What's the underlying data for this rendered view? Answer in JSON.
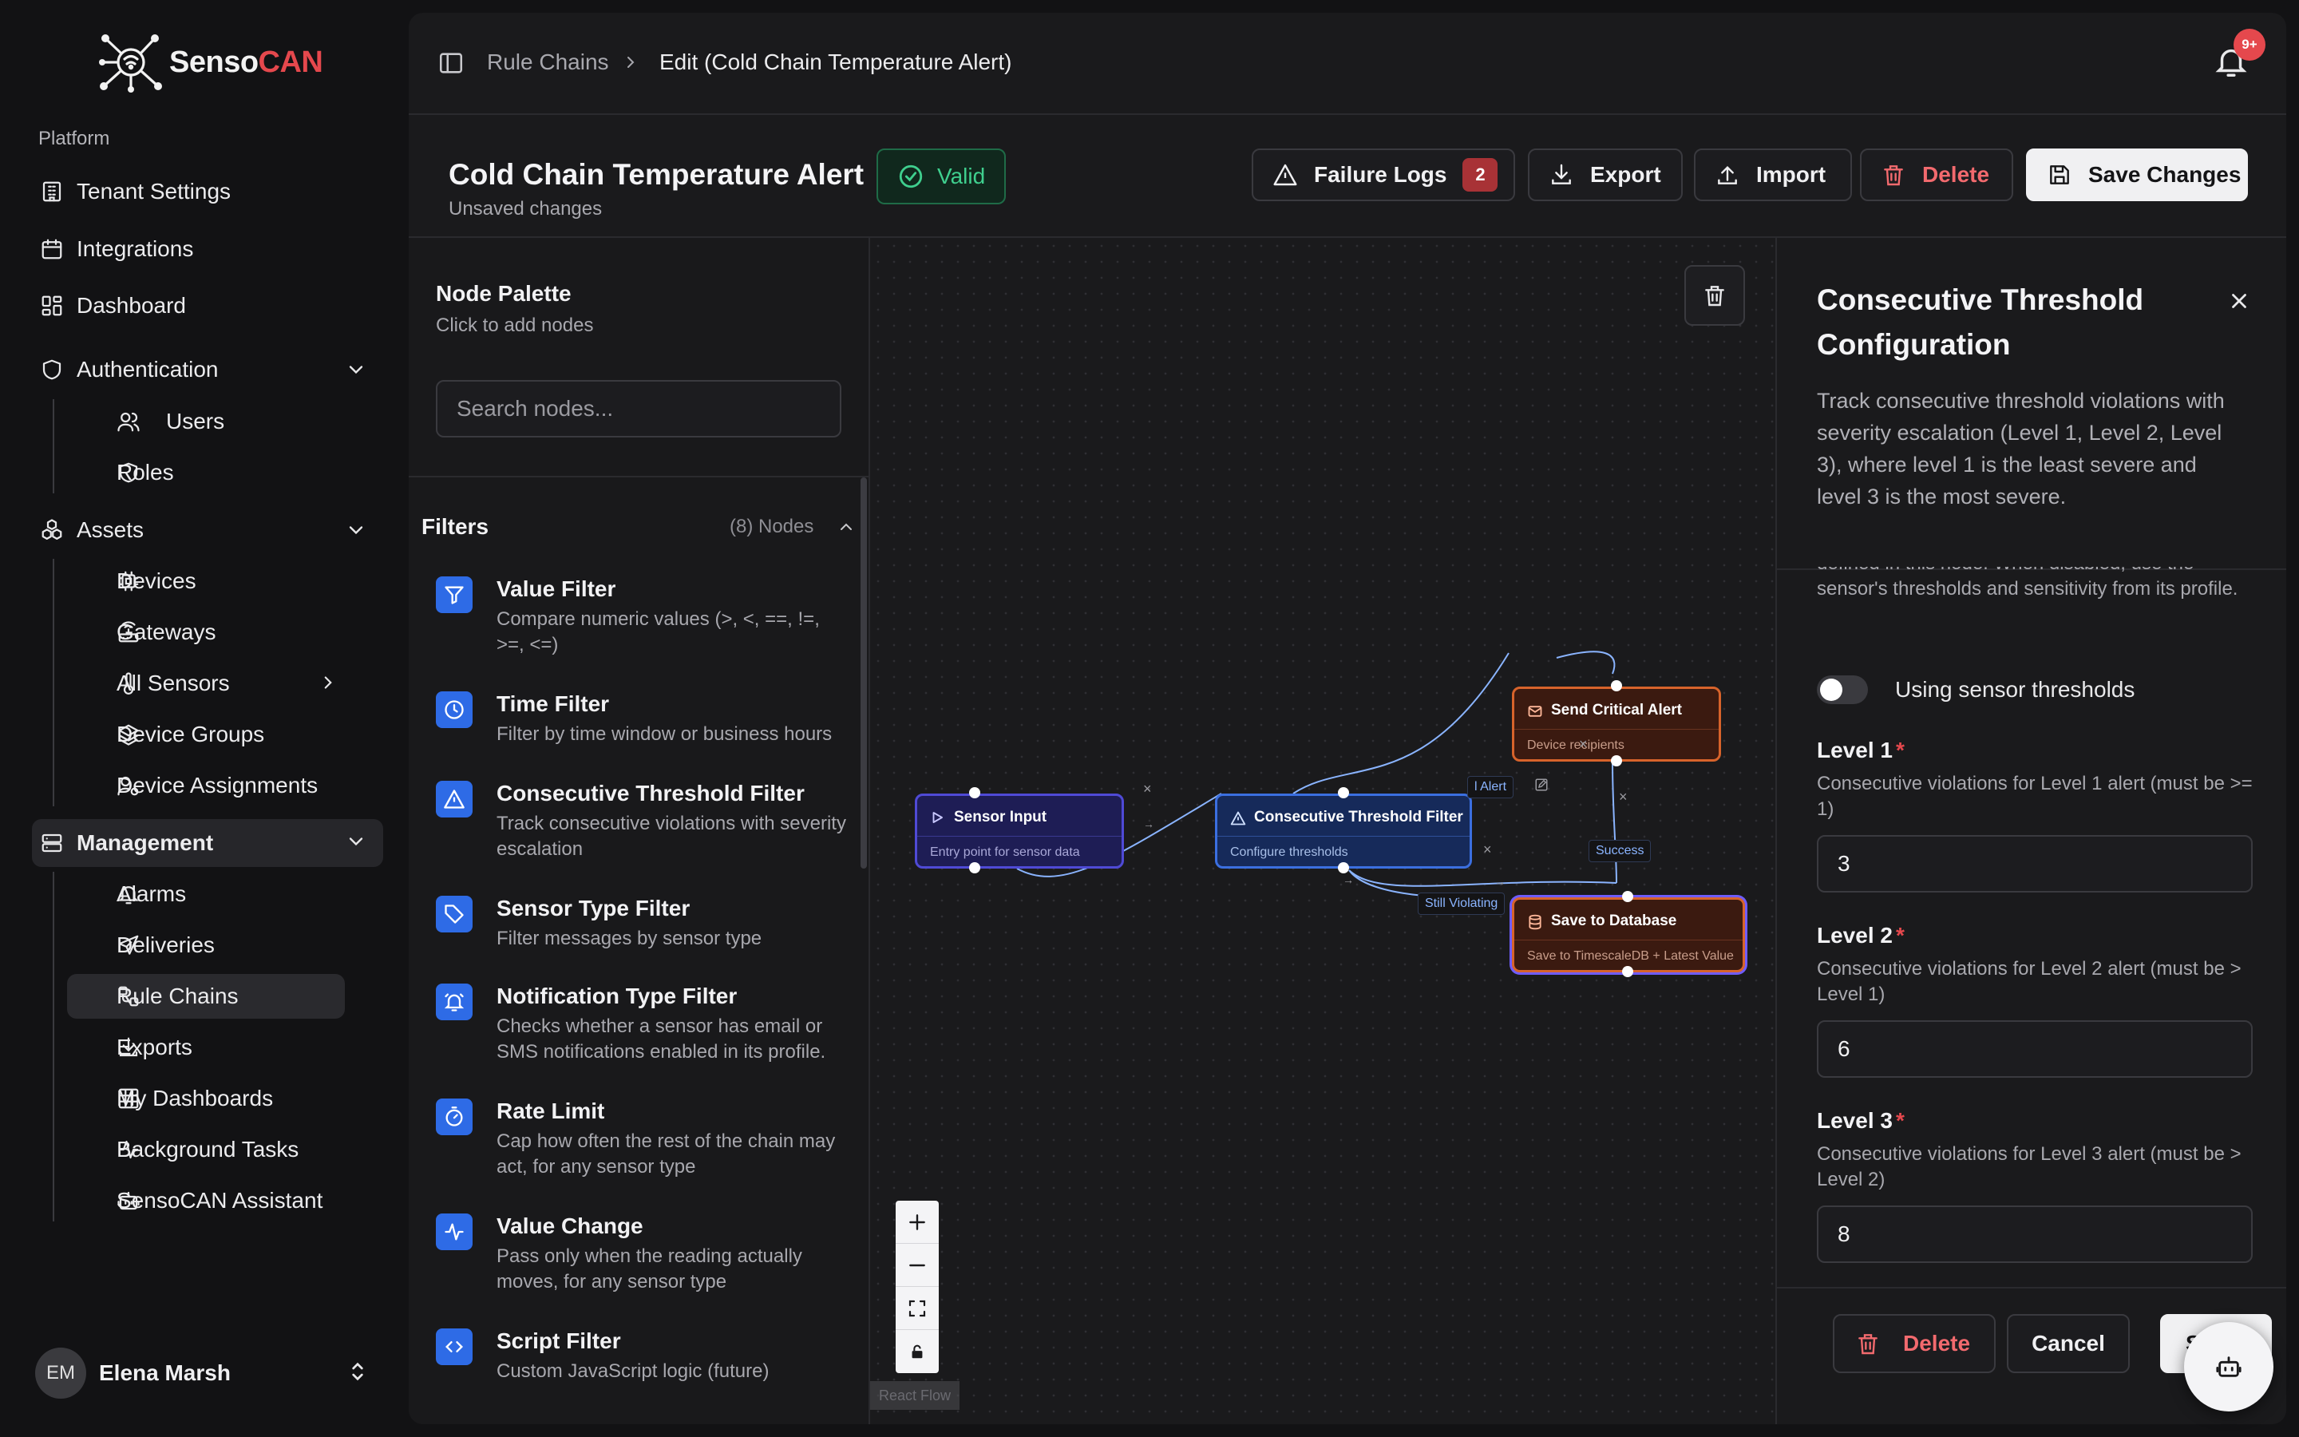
{
  "app": {
    "brand_prefix": "Senso",
    "brand_accent": "CAN",
    "accent_color": "#e5484d"
  },
  "sidebar": {
    "section_label": "Platform",
    "items": {
      "tenant_settings": "Tenant Settings",
      "integrations": "Integrations",
      "dashboard": "Dashboard",
      "authentication": "Authentication",
      "users": "Users",
      "roles": "Roles",
      "assets": "Assets",
      "devices": "Devices",
      "gateways": "Gateways",
      "all_sensors": "All Sensors",
      "device_groups": "Device Groups",
      "device_assignments": "Device Assignments",
      "management": "Management",
      "alarms": "Alarms",
      "deliveries": "Deliveries",
      "rule_chains": "Rule Chains",
      "exports": "Exports",
      "my_dashboards": "My Dashboards",
      "background_tasks": "Background Tasks",
      "senso_assistant": "SensoCAN Assistant"
    },
    "user": {
      "initials": "EM",
      "name": "Elena Marsh"
    }
  },
  "topbar": {
    "breadcrumb_root": "Rule Chains",
    "breadcrumb_current": "Edit (Cold Chain Temperature Alert)",
    "notification_count": "9+"
  },
  "header": {
    "title": "Cold Chain Temperature Alert",
    "subtitle": "Unsaved changes",
    "valid_label": "Valid",
    "failure_logs_label": "Failure Logs",
    "failure_logs_count": "2",
    "export_label": "Export",
    "import_label": "Import",
    "delete_label": "Delete",
    "save_label": "Save Changes"
  },
  "palette": {
    "title": "Node Palette",
    "subtitle": "Click to add nodes",
    "search_placeholder": "Search nodes...",
    "section_title": "Filters",
    "section_count": "(8) Nodes",
    "items": [
      {
        "title": "Value Filter",
        "desc": "Compare numeric values (>, <, ==, !=, >=, <=)",
        "icon": "filter-icon"
      },
      {
        "title": "Time Filter",
        "desc": "Filter by time window or business hours",
        "icon": "clock-icon"
      },
      {
        "title": "Consecutive Threshold Filter",
        "desc": "Track consecutive violations with severity escalation",
        "icon": "warning-icon"
      },
      {
        "title": "Sensor Type Filter",
        "desc": "Filter messages by sensor type",
        "icon": "tag-icon"
      },
      {
        "title": "Notification Type Filter",
        "desc": "Checks whether a sensor has email or SMS notifications enabled in its profile.",
        "icon": "bell-icon"
      },
      {
        "title": "Rate Limit",
        "desc": "Cap how often the rest of the chain may act, for any sensor type",
        "icon": "timer-icon"
      },
      {
        "title": "Value Change",
        "desc": "Pass only when the reading actually moves, for any sensor type",
        "icon": "activity-icon"
      },
      {
        "title": "Script Filter",
        "desc": "Custom JavaScript logic (future)",
        "icon": "code-icon"
      }
    ]
  },
  "canvas": {
    "attribution": "React Flow",
    "nodes": {
      "sensor_input": {
        "title": "Sensor Input",
        "desc": "Entry point for sensor data"
      },
      "threshold": {
        "title": "Consecutive Threshold Filter",
        "desc": "Configure thresholds"
      },
      "critical_alert": {
        "title": "Send Critical Alert",
        "desc": "Device recipients"
      },
      "save_db": {
        "title": "Save to Database",
        "desc": "Save to TimescaleDB + Latest Value"
      }
    },
    "edge_labels": {
      "alert": "l Alert",
      "success": "Success",
      "still_violating": "Still Violating"
    }
  },
  "config": {
    "title": "Consecutive Threshold Configuration",
    "description": "Track consecutive threshold violations with severity escalation (Level 1, Level 2, Level 3), where level 1 is the least severe and level 3 is the most severe.",
    "toggle_help": "defined in this node. When disabled, use the sensor's thresholds and sensitivity from its profile.",
    "toggle_label": "Using sensor thresholds",
    "level1_label": "Level 1",
    "level1_help": "Consecutive violations for Level 1 alert (must be >= 1)",
    "level1_value": "3",
    "level2_label": "Level 2",
    "level2_help": "Consecutive violations for Level 2 alert (must be > Level 1)",
    "level2_value": "6",
    "level3_label": "Level 3",
    "level3_help": "Consecutive violations for Level 3 alert (must be > Level 2)",
    "level3_value": "8",
    "required_mark": "*",
    "delete_label": "Delete",
    "cancel_label": "Cancel",
    "save_label": "Sa"
  }
}
